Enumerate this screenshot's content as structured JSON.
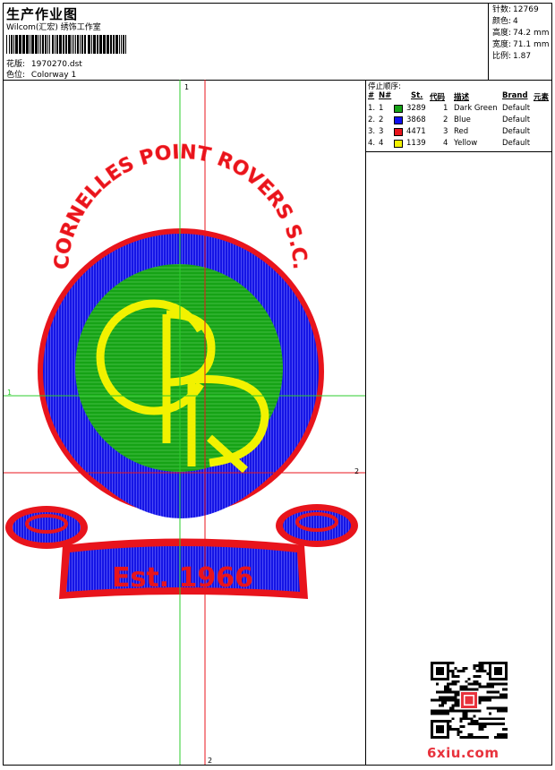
{
  "header": {
    "title": "生产作业图",
    "studio": "Wilcom(汇宏) 绣饰工作室",
    "design_label": "花版:",
    "design_value": "1970270.dst",
    "colorway_label": "色位:",
    "colorway_value": "Colorway 1"
  },
  "stats": [
    {
      "label": "针数:",
      "value": "12769"
    },
    {
      "label": "颜色:",
      "value": "4"
    },
    {
      "label": "高度:",
      "value": "74.2 mm"
    },
    {
      "label": "宽度:",
      "value": "71.1 mm"
    },
    {
      "label": "比例:",
      "value": "1.87"
    }
  ],
  "color_table": {
    "title": "停止顺序:",
    "headers": {
      "num": "#",
      "n": "N#",
      "st": "St.",
      "code": "代码",
      "desc": "描述",
      "brand": "Brand",
      "elem": "元素"
    },
    "rows": [
      {
        "num": "1.",
        "n": "1",
        "color": "#16a316",
        "st": "3289",
        "code": "1",
        "desc": "Dark Green",
        "brand": "Default"
      },
      {
        "num": "2.",
        "n": "2",
        "color": "#1010ee",
        "st": "3868",
        "code": "2",
        "desc": "Blue",
        "brand": "Default"
      },
      {
        "num": "3.",
        "n": "3",
        "color": "#e8141c",
        "st": "4471",
        "code": "3",
        "desc": "Red",
        "brand": "Default"
      },
      {
        "num": "4.",
        "n": "4",
        "color": "#f2f200",
        "st": "1139",
        "code": "4",
        "desc": "Yellow",
        "brand": "Default"
      }
    ]
  },
  "design": {
    "ring_text": "CORNELLES POINT ROVERS S.C.",
    "monogram": "CPR",
    "banner_text": "Est. 1966",
    "guide_labels": {
      "v_top": "1",
      "h_left": "1",
      "h_right": "2",
      "v_bottom": "2"
    }
  },
  "watermark": "6xiu.com"
}
